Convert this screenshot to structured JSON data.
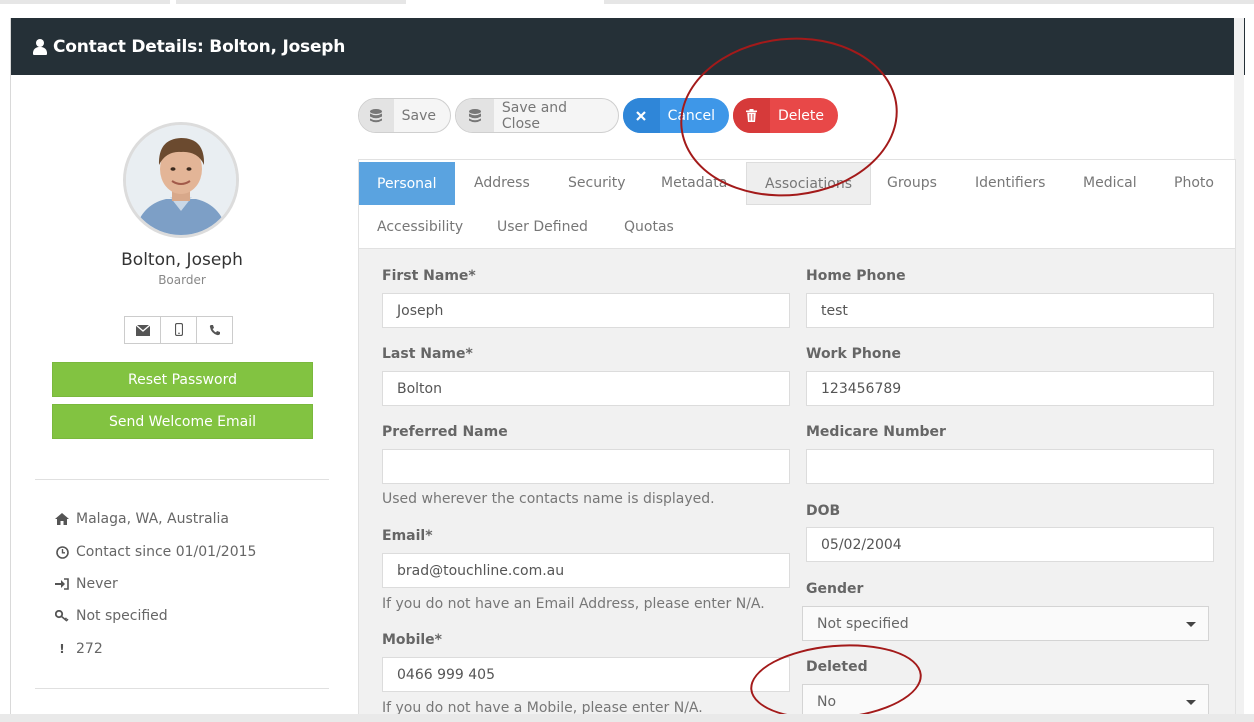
{
  "window": {
    "title": "Contact Details: Bolton, Joseph"
  },
  "profile": {
    "name": "Bolton, Joseph",
    "role": "Boarder",
    "reset_password_label": "Reset Password",
    "send_welcome_label": "Send Welcome Email",
    "info": [
      {
        "icon": "home-icon",
        "text": "Malaga, WA, Australia"
      },
      {
        "icon": "clock-icon",
        "text": "Contact since 01/01/2015"
      },
      {
        "icon": "sign-in-icon",
        "text": "Never"
      },
      {
        "icon": "key-icon",
        "text": "Not specified"
      },
      {
        "icon": "exclamation-icon",
        "text": "272"
      }
    ]
  },
  "toolbar": {
    "save_label": "Save",
    "save_close_label": "Save and Close",
    "cancel_label": "Cancel",
    "delete_label": "Delete"
  },
  "tabs": {
    "row1": [
      "Personal",
      "Address",
      "Security",
      "Metadata",
      "Associations",
      "Groups",
      "Identifiers",
      "Medical",
      "Photo"
    ],
    "row2": [
      "Accessibility",
      "User Defined",
      "Quotas"
    ],
    "active": "Personal"
  },
  "form": {
    "first_name": {
      "label": "First Name*",
      "value": "Joseph"
    },
    "last_name": {
      "label": "Last Name*",
      "value": "Bolton"
    },
    "preferred_name": {
      "label": "Preferred Name",
      "value": "",
      "help": "Used wherever the contacts name is displayed."
    },
    "email": {
      "label": "Email*",
      "value": "brad@touchline.com.au",
      "help": "If you do not have an Email Address, please enter N/A."
    },
    "mobile": {
      "label": "Mobile*",
      "value": "0466 999 405",
      "help": "If you do not have a Mobile, please enter N/A."
    },
    "home_phone": {
      "label": "Home Phone",
      "value": "test"
    },
    "work_phone": {
      "label": "Work Phone",
      "value": "123456789"
    },
    "medicare": {
      "label": "Medicare Number",
      "value": ""
    },
    "dob": {
      "label": "DOB",
      "value": "05/02/2004"
    },
    "gender": {
      "label": "Gender",
      "value": "Not specified"
    },
    "deleted": {
      "label": "Deleted",
      "value": "No"
    }
  },
  "colors": {
    "header_bg": "#253037",
    "green": "#82c341",
    "blue": "#3e97e8",
    "red": "#e84848",
    "tab_active": "#5aa3e0",
    "annotation": "#a31a1a"
  }
}
